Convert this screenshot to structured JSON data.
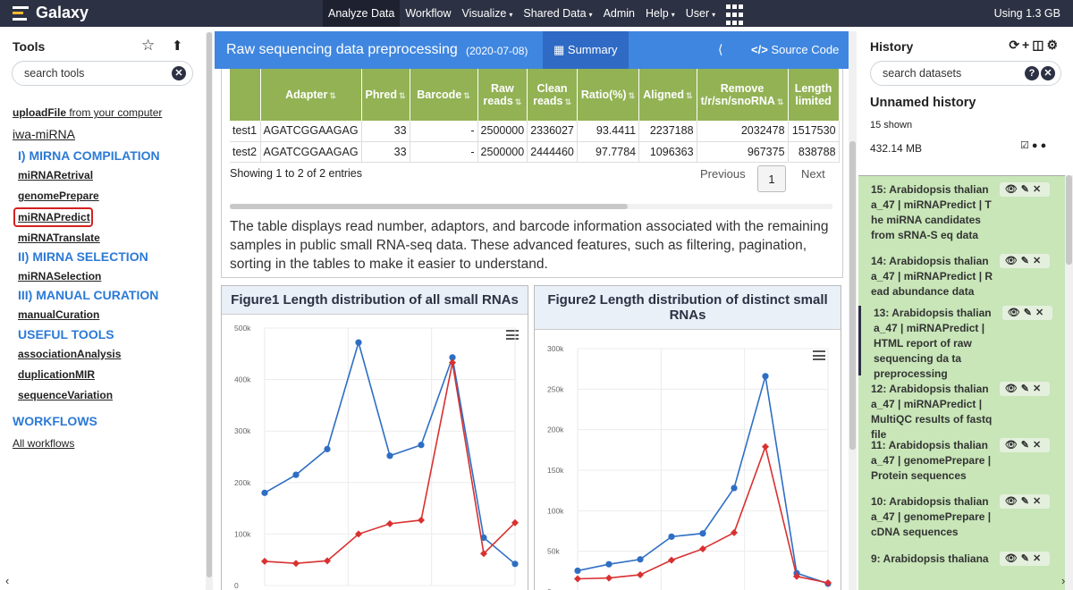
{
  "masthead": {
    "brand": "Galaxy",
    "nav": [
      {
        "label": "Analyze Data",
        "caret": ""
      },
      {
        "label": "Workflow",
        "caret": ""
      },
      {
        "label": "Visualize",
        "caret": "▾"
      },
      {
        "label": "Shared Data",
        "caret": "▾"
      },
      {
        "label": "Admin",
        "caret": ""
      },
      {
        "label": "Help",
        "caret": "▾"
      },
      {
        "label": "User",
        "caret": "▾"
      }
    ],
    "usage": "Using 1.3 GB"
  },
  "tools": {
    "title": "Tools",
    "star": "☆",
    "upload": "⬆",
    "search_placeholder": "search tools",
    "upload_link": "uploadFile",
    "upload_suffix": " from your computer",
    "section_title": "iwa-miRNA",
    "sec1": "I) MIRNA COMPILATION",
    "t1": "miRNARetrival",
    "t2": "genomePrepare",
    "t3": "miRNAPredict",
    "t4": "miRNATranslate",
    "sec2": "II) MIRNA SELECTION",
    "t5": "miRNASelection",
    "sec3": "III) MANUAL CURATION",
    "t6": "manualCuration",
    "sec4": "USEFUL TOOLS",
    "t7": "associationAnalysis",
    "t8": "duplicationMIR",
    "t9": "sequenceVariation",
    "workflows": "WORKFLOWS",
    "all_workflows": "All workflows"
  },
  "report": {
    "title": "Raw sequencing data preprocessing",
    "date": "(2020-07-08)",
    "summary_tab": "Summary",
    "source_code": "Source Code",
    "columns": [
      "",
      "Adapter",
      "Phred",
      "Barcode",
      "Raw reads",
      "Clean reads",
      "Ratio(%)",
      "Aligned",
      "Remove t/r/sn/snoRNA",
      "Length limited"
    ],
    "rows": [
      [
        "test1",
        "AGATCGGAAGAG",
        "33",
        "-",
        "2500000",
        "2336027",
        "93.4411",
        "2237188",
        "2032478",
        "1517530"
      ],
      [
        "test2",
        "AGATCGGAAGAG",
        "33",
        "-",
        "2500000",
        "2444460",
        "97.7784",
        "1096363",
        "967375",
        "838788"
      ]
    ],
    "entries": "Showing 1 to 2 of 2 entries",
    "prev": "Previous",
    "page": "1",
    "next": "Next",
    "description": "The table displays read number, adaptors, and barcode information associated with the remaining samples in public small RNA-seq data. These advanced features, such as filtering, pagination, sorting in the tables to make it easier to understand."
  },
  "chart_data": [
    {
      "type": "line",
      "title": "Figure1 Length distribution of all small RNAs",
      "ylim": [
        0,
        500000
      ],
      "yticks": [
        "500k",
        "400k",
        "300k",
        "200k",
        "100k",
        "0"
      ],
      "ytick_values": [
        500000,
        400000,
        300000,
        200000,
        100000,
        0
      ],
      "series": [
        {
          "color": "#2e6ec4",
          "values": [
            180000,
            215000,
            265000,
            472000,
            252000,
            273000,
            443000,
            93000,
            42000
          ]
        },
        {
          "color": "#d93030",
          "values": [
            47000,
            43000,
            48000,
            100000,
            120000,
            127000,
            433000,
            62000,
            122000
          ]
        }
      ]
    },
    {
      "type": "line",
      "title": "Figure2 Length distribution of distinct small RNAs",
      "ylim": [
        0,
        300000
      ],
      "yticks": [
        "300k",
        "250k",
        "200k",
        "150k",
        "100k",
        "50k",
        "0"
      ],
      "ytick_values": [
        300000,
        250000,
        200000,
        150000,
        100000,
        50000,
        0
      ],
      "series": [
        {
          "color": "#2e6ec4",
          "values": [
            26000,
            34000,
            40000,
            68000,
            72000,
            128000,
            266000,
            23000,
            10000
          ]
        },
        {
          "color": "#d93030",
          "values": [
            16000,
            17000,
            21000,
            39000,
            53000,
            73000,
            179000,
            19000,
            11000
          ]
        }
      ]
    }
  ],
  "history": {
    "title": "History",
    "icons": "⟳+◫⚙",
    "search_placeholder": "search datasets",
    "name": "Unnamed history",
    "shown": "15 shown",
    "size": "432.14 MB",
    "tags": "☑ ● ●",
    "items": [
      {
        "text": "15: Arabidopsis thalian a_47 | miRNAPredict | T he miRNA candidates from sRNA-S eq data"
      },
      {
        "text": "14: Arabidopsis thalian a_47 | miRNAPredict | R ead abundance data"
      },
      {
        "text": "13: Arabidopsis thalian a_47 | miRNAPredict | HTML report of raw sequencing da ta preprocessing"
      },
      {
        "text": "12: Arabidopsis thalian a_47 | miRNAPredict | MultiQC results of fastq file"
      },
      {
        "text": "11: Arabidopsis thalian a_47 | genomePrepare | Protein sequences"
      },
      {
        "text": "10: Arabidopsis thalian a_47 | genomePrepare | cDNA sequences"
      },
      {
        "text": "9: Arabidopsis thaliana"
      }
    ],
    "actions": "👁✎✕"
  }
}
